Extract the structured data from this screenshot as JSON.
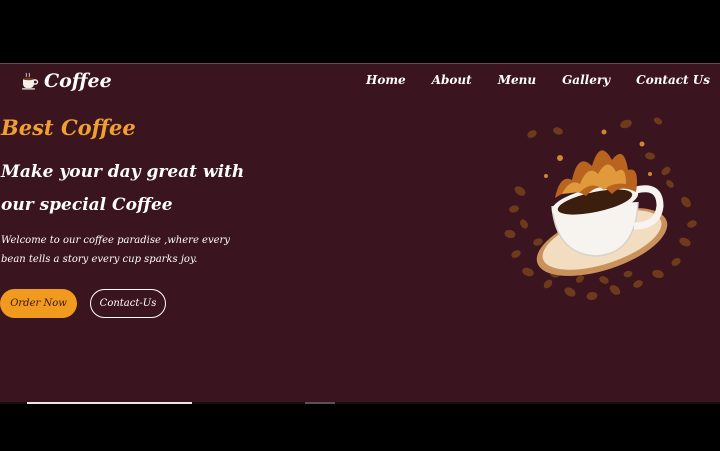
{
  "brand": {
    "name": "Coffee",
    "icon": "coffee-cup-icon"
  },
  "nav": {
    "items": [
      {
        "label": "Home"
      },
      {
        "label": "About"
      },
      {
        "label": "Menu"
      },
      {
        "label": "Gallery"
      },
      {
        "label": "Contact Us"
      }
    ]
  },
  "hero": {
    "tagline": "Best Coffee",
    "title": "Make your day great with our special Coffee",
    "description": "Welcome to our coffee paradise ,where every bean tells a story every cup sparks joy.",
    "primary_button": "Order Now",
    "secondary_button": "Contact-Us",
    "image": "coffee-splash-image"
  },
  "colors": {
    "background": "#3a141e",
    "accent": "#f19b1e",
    "text": "#ffffff"
  }
}
